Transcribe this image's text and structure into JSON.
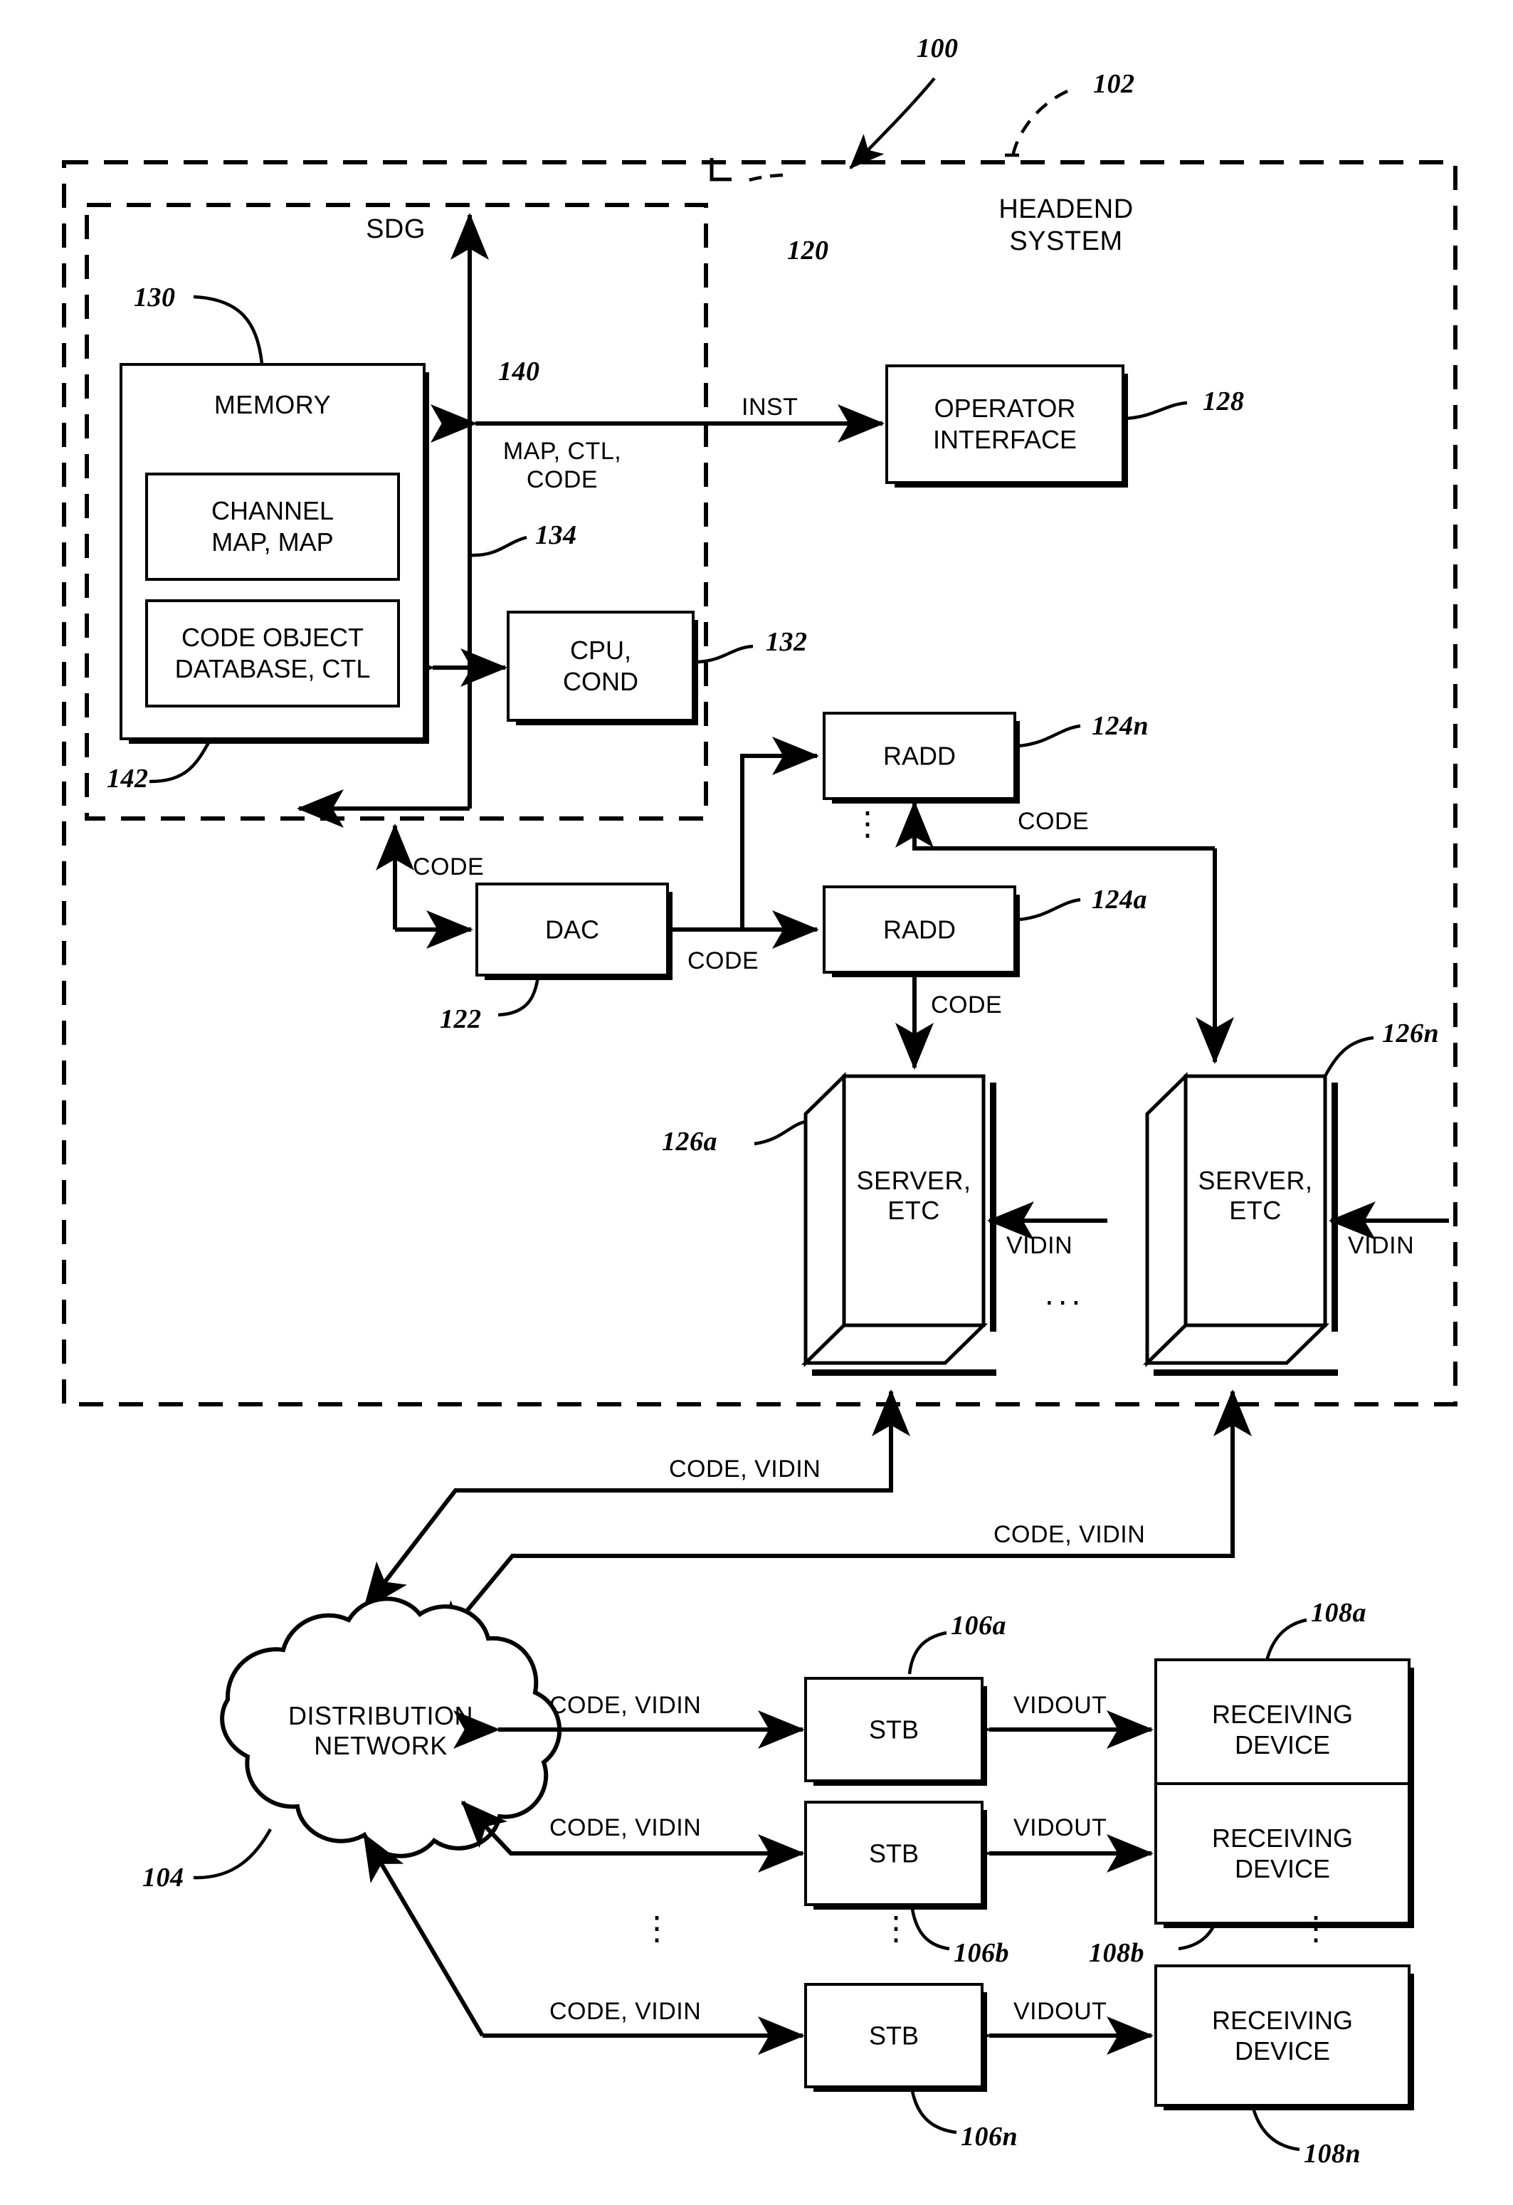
{
  "figure": {
    "system_ref": "100",
    "headend_ref": "102",
    "headend_title_line1": "HEADEND",
    "headend_title_line2": "SYSTEM",
    "sdg_label": "SDG",
    "sdg_ref": "120"
  },
  "sdg": {
    "memory": {
      "label": "MEMORY",
      "ref": "130",
      "channel_map": {
        "line1": "CHANNEL",
        "line2": "MAP, MAP"
      },
      "code_object": {
        "line1": "CODE OBJECT",
        "line2": "DATABASE, CTL",
        "ref": "142"
      }
    },
    "cpu": {
      "line1": "CPU,",
      "line2": "COND",
      "ref": "132"
    },
    "bus_ref_140": "140",
    "bus_ref_134": "134",
    "bus_signals": {
      "line1": "MAP, CTL,",
      "line2": "CODE"
    }
  },
  "headend": {
    "operator_interface": {
      "line1": "OPERATOR",
      "line2": "INTERFACE",
      "ref": "128"
    },
    "inst_label": "INST",
    "dac": {
      "label": "DAC",
      "ref": "122"
    },
    "radd_n": {
      "label": "RADD",
      "ref": "124n"
    },
    "radd_a": {
      "label": "RADD",
      "ref": "124a"
    },
    "server_a": {
      "line1": "SERVER,",
      "line2": "ETC",
      "ref": "126a"
    },
    "server_n": {
      "line1": "SERVER,",
      "line2": "ETC",
      "ref": "126n"
    },
    "code_label": "CODE",
    "vidin_label": "VIDIN",
    "ellipsis_vertical": "⋮",
    "ellipsis_horizontal": "..."
  },
  "network": {
    "cloud": {
      "line1": "DISTRIBUTION",
      "line2": "NETWORK",
      "ref": "104"
    },
    "code_vidin_label": "CODE, VIDIN"
  },
  "subscribers": {
    "vidout_label": "VIDOUT",
    "code_vidin_label": "CODE, VIDIN",
    "rows": [
      {
        "stb_label": "STB",
        "stb_ref": "106a",
        "device_line1": "RECEIVING",
        "device_line2": "DEVICE",
        "device_ref": "108a"
      },
      {
        "stb_label": "STB",
        "stb_ref": "106b",
        "device_line1": "RECEIVING",
        "device_line2": "DEVICE",
        "device_ref": "108b"
      },
      {
        "stb_label": "STB",
        "stb_ref": "106n",
        "device_line1": "RECEIVING",
        "device_line2": "DEVICE",
        "device_ref": "108n"
      }
    ]
  }
}
